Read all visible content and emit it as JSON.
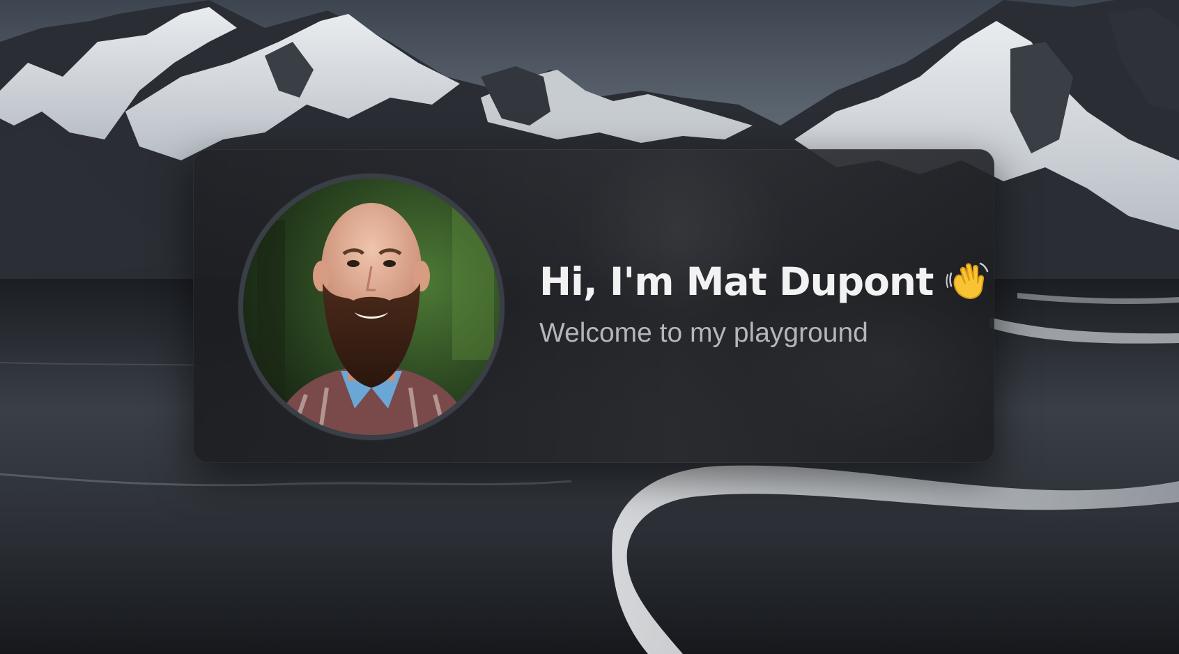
{
  "hero": {
    "heading": "Hi, I'm Mat Dupont",
    "subtitle": "Welcome to my playground",
    "emoji_icon": "waving-hand-icon",
    "avatar_description": "profile-photo"
  },
  "colors": {
    "card_background": "#26282d",
    "heading_text": "#f2f2f2",
    "subtitle_text": "#b4b6ba",
    "avatar_ring": "#3a3e47"
  }
}
